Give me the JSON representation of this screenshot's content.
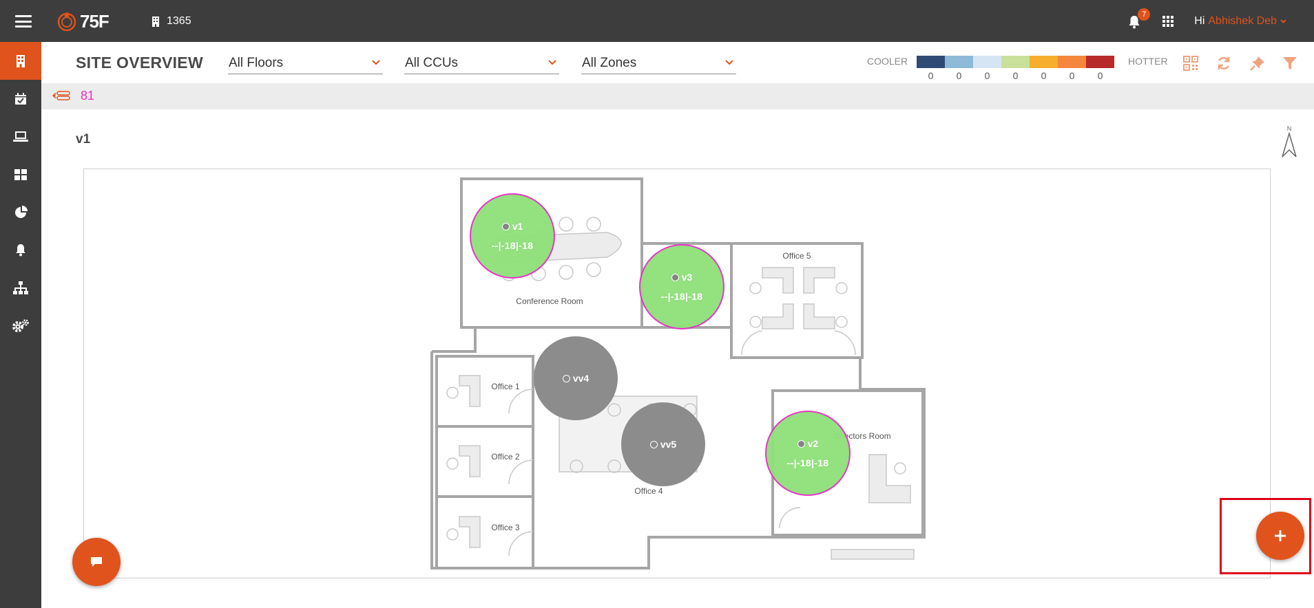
{
  "topbar": {
    "logo_text": "75F",
    "building_id": "1365",
    "notification_count": "7",
    "greeting": "Hi",
    "user_name": "Abhishek Deb"
  },
  "header": {
    "title": "SITE OVERVIEW",
    "floors_select": "All Floors",
    "ccus_select": "All CCUs",
    "zones_select": "All Zones",
    "legend": {
      "cooler_label": "COOLER",
      "hotter_label": "HOTTER",
      "colors": [
        "#2f4a75",
        "#8dbbd7",
        "#d6e5f3",
        "#c8e09a",
        "#f7ae2c",
        "#f4873c",
        "#b82a2a"
      ],
      "counts": [
        "0",
        "0",
        "0",
        "0",
        "0",
        "0",
        "0"
      ]
    }
  },
  "subbar": {
    "count": "81"
  },
  "floor": {
    "name": "v1",
    "north_label": "N",
    "rooms": {
      "conference": "Conference Room",
      "office5": "Office 5",
      "office1": "Office 1",
      "office2": "Office 2",
      "office3": "Office 3",
      "office4": "Office 4",
      "directors": "Directors Room"
    },
    "zones": [
      {
        "name": "v1",
        "temps": "--|-18|-18",
        "status": "green"
      },
      {
        "name": "v3",
        "temps": "--|-18|-18",
        "status": "green"
      },
      {
        "name": "vv4",
        "temps": "",
        "status": "gray"
      },
      {
        "name": "vv5",
        "temps": "",
        "status": "gray"
      },
      {
        "name": "v2",
        "temps": "--|-18|-18",
        "status": "green"
      }
    ]
  },
  "colors": {
    "accent": "#e0531c",
    "dark": "#3d3d3d",
    "zone_green": "#8fe07a",
    "zone_border": "#e72ec6",
    "zone_gray": "#8c8c8c"
  },
  "icons": [
    "menu-icon",
    "building-icon",
    "bell-icon",
    "apps-grid-icon",
    "calendar-icon",
    "laptop-icon",
    "dashboard-icon",
    "pie-chart-icon",
    "alert-bell-icon",
    "org-tree-icon",
    "settings-icon",
    "qr-code-icon",
    "refresh-icon",
    "pin-icon",
    "filter-icon",
    "stack-icon",
    "north-arrow-icon",
    "plus-icon",
    "chat-icon"
  ]
}
